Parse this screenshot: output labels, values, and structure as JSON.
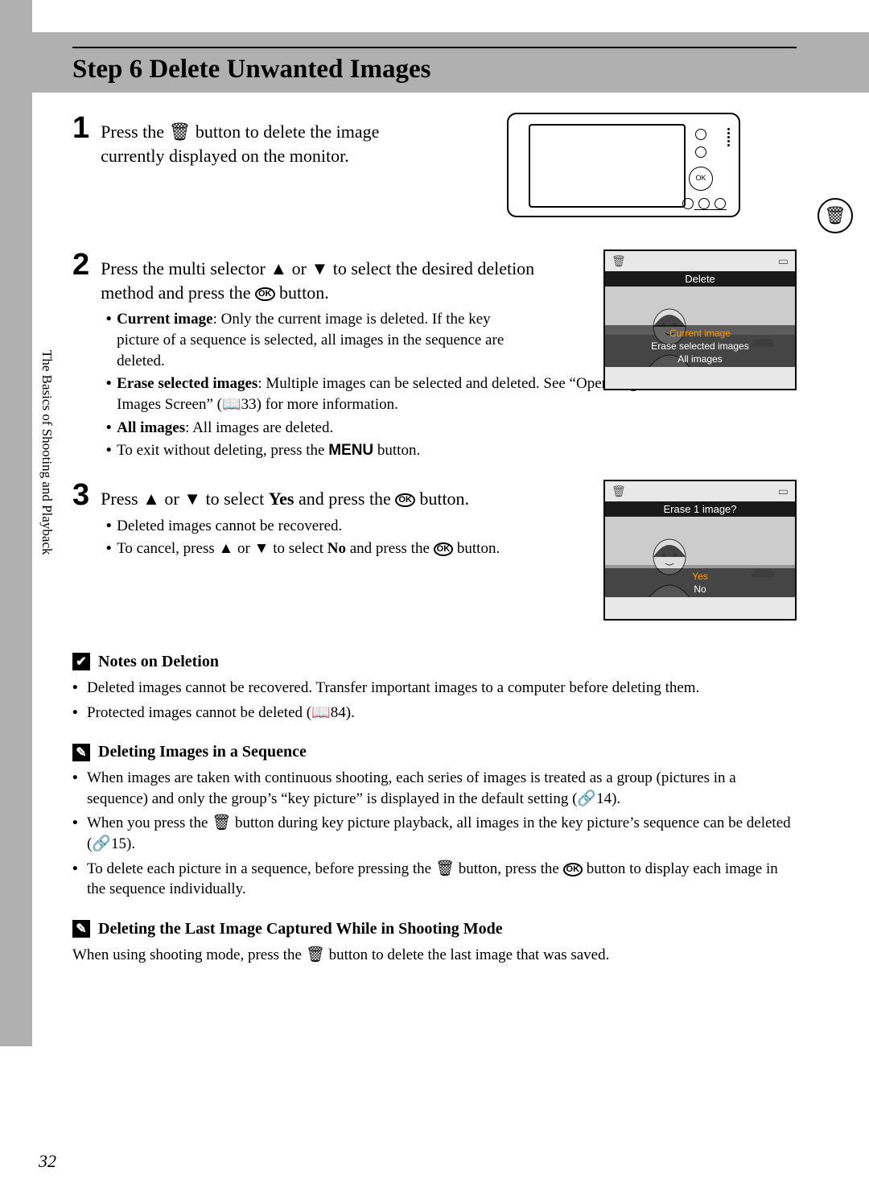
{
  "header": {
    "title": "Step 6 Delete Unwanted Images"
  },
  "sidebar": {
    "label": "The Basics of Shooting and Playback"
  },
  "steps": {
    "s1": {
      "num": "1",
      "head_a": "Press the ",
      "head_b": " button to delete the image currently displayed on the monitor."
    },
    "s2": {
      "num": "2",
      "head_a": "Press the multi selector ",
      "head_b": " or ",
      "head_c": " to select the desired deletion method and press the ",
      "head_d": " button.",
      "b1_label": "Current image",
      "b1_text": ": Only the current image is deleted. If the key picture of a sequence is selected, all images in the sequence are deleted.",
      "b2_label": "Erase selected images",
      "b2_text_a": ": Multiple images can be selected and deleted. See “Operating the Erase Selected Images Screen” (",
      "b2_ref": "33",
      "b2_text_b": ") for more information.",
      "b3_label": "All images",
      "b3_text": ": All images are deleted.",
      "b4_text_a": "To exit without deleting, press the ",
      "b4_menu": "MENU",
      "b4_text_b": " button."
    },
    "s3": {
      "num": "3",
      "head_a": "Press ",
      "head_b": " or ",
      "head_c": " to select ",
      "head_yes": "Yes",
      "head_d": " and press the ",
      "head_e": " button.",
      "b1": "Deleted images cannot be recovered.",
      "b2_a": "To cancel, press ",
      "b2_b": " or ",
      "b2_c": " to select ",
      "b2_no": "No",
      "b2_d": " and press the ",
      "b2_e": " button."
    }
  },
  "lcd1": {
    "title": "Delete",
    "opt_current": "Current image",
    "opt_erase": "Erase selected images",
    "opt_all": "All images"
  },
  "lcd2": {
    "title": "Erase 1 image?",
    "opt_yes": "Yes",
    "opt_no": "No"
  },
  "notes": {
    "n1": {
      "title": "Notes on Deletion",
      "b1": "Deleted images cannot be recovered. Transfer important images to a computer before deleting them.",
      "b2_a": "Protected images cannot be deleted (",
      "b2_ref": "84",
      "b2_b": ")."
    },
    "n2": {
      "title": "Deleting Images in a Sequence",
      "b1_a": "When images are taken with continuous shooting, each series of images is treated as a group (pictures in a sequence) and only the group’s “key picture” is displayed in the default setting (",
      "b1_ref": "14",
      "b1_b": ").",
      "b2_a": "When you press the ",
      "b2_b": " button during key picture playback, all images in the key picture’s sequence can be deleted (",
      "b2_ref": "15",
      "b2_c": ").",
      "b3_a": "To delete each picture in a sequence, before pressing the ",
      "b3_b": " button, press the ",
      "b3_c": " button to display each image in the sequence individually."
    },
    "n3": {
      "title": "Deleting the Last Image Captured While in Shooting Mode",
      "b1_a": "When using shooting mode, press the ",
      "b1_b": " button to delete the last image that was saved."
    }
  },
  "page_number": "32",
  "glyphs": {
    "trash": "🗑",
    "up": "▲",
    "down": "▼",
    "ok": "OK",
    "book": "📖",
    "ref": "🔗",
    "battery": "▭"
  }
}
